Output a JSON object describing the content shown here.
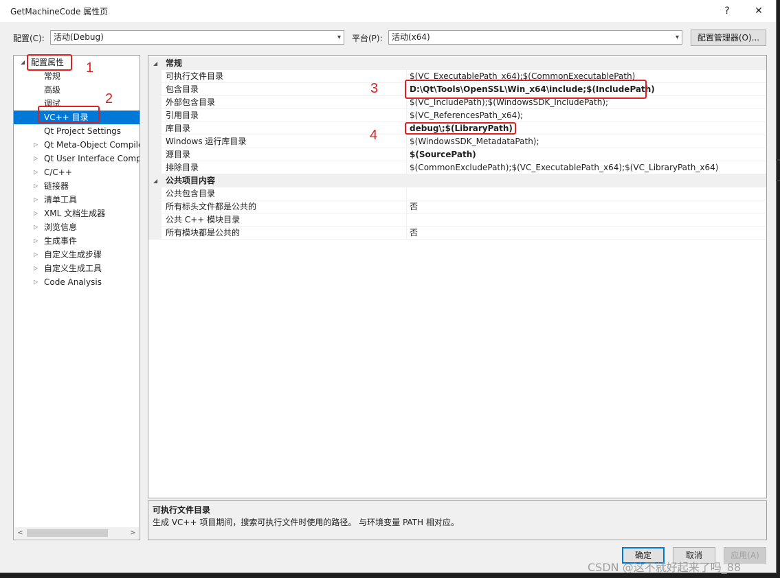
{
  "window": {
    "title": "GetMachineCode 属性页",
    "help": "?",
    "close": "✕"
  },
  "config": {
    "config_label": "配置(C):",
    "config_value": "活动(Debug)",
    "platform_label": "平台(P):",
    "platform_value": "活动(x64)",
    "manager_button": "配置管理器(O)..."
  },
  "tree": {
    "items": [
      {
        "label": "配置属性",
        "expander": "◢"
      },
      {
        "label": "常规",
        "expander": ""
      },
      {
        "label": "高级",
        "expander": ""
      },
      {
        "label": "调试",
        "expander": ""
      },
      {
        "label": "VC++ 目录",
        "expander": ""
      },
      {
        "label": "Qt Project Settings",
        "expander": ""
      },
      {
        "label": "Qt Meta-Object Compiler",
        "expander": "▷"
      },
      {
        "label": "Qt User Interface Compiler",
        "expander": "▷"
      },
      {
        "label": "C/C++",
        "expander": "▷"
      },
      {
        "label": "链接器",
        "expander": "▷"
      },
      {
        "label": "清单工具",
        "expander": "▷"
      },
      {
        "label": "XML 文档生成器",
        "expander": "▷"
      },
      {
        "label": "浏览信息",
        "expander": "▷"
      },
      {
        "label": "生成事件",
        "expander": "▷"
      },
      {
        "label": "自定义生成步骤",
        "expander": "▷"
      },
      {
        "label": "自定义生成工具",
        "expander": "▷"
      },
      {
        "label": "Code Analysis",
        "expander": "▷"
      }
    ],
    "selected_label": "VC++ 目录"
  },
  "grid": {
    "categories": [
      {
        "name": "常规",
        "rows": [
          {
            "name": "可执行文件目录",
            "value": "$(VC_ExecutablePath_x64);$(CommonExecutablePath)",
            "bold": false
          },
          {
            "name": "包含目录",
            "value": "D:\\Qt\\Tools\\OpenSSL\\Win_x64\\include;$(IncludePath)",
            "bold": true
          },
          {
            "name": "外部包含目录",
            "value": "$(VC_IncludePath);$(WindowsSDK_IncludePath);",
            "bold": false
          },
          {
            "name": "引用目录",
            "value": "$(VC_ReferencesPath_x64);",
            "bold": false
          },
          {
            "name": "库目录",
            "value": "debug\\;$(LibraryPath)",
            "bold": true
          },
          {
            "name": "Windows 运行库目录",
            "value": "$(WindowsSDK_MetadataPath);",
            "bold": false
          },
          {
            "name": "源目录",
            "value": "$(SourcePath)",
            "bold": true
          },
          {
            "name": "排除目录",
            "value": "$(CommonExcludePath);$(VC_ExecutablePath_x64);$(VC_LibraryPath_x64)",
            "bold": false
          }
        ]
      },
      {
        "name": "公共项目内容",
        "rows": [
          {
            "name": "公共包含目录",
            "value": "",
            "bold": false
          },
          {
            "name": "所有标头文件都是公共的",
            "value": "否",
            "bold": false
          },
          {
            "name": "公共 C++ 模块目录",
            "value": "",
            "bold": false
          },
          {
            "name": "所有模块都是公共的",
            "value": "否",
            "bold": false
          }
        ]
      }
    ]
  },
  "description": {
    "title": "可执行文件目录",
    "text": "生成 VC++ 项目期间，搜索可执行文件时使用的路径。 与环境变量 PATH 相对应。"
  },
  "buttons": {
    "ok": "确定",
    "cancel": "取消",
    "apply": "应用(A)"
  },
  "annotations": {
    "n1": "1",
    "n2": "2",
    "n3": "3",
    "n4": "4",
    "color": "#e02020"
  },
  "watermark": "CSDN @这不就好起来了吗_88",
  "colors": {
    "selection": "#0078d7",
    "window_bg": "#f0f0f0"
  }
}
